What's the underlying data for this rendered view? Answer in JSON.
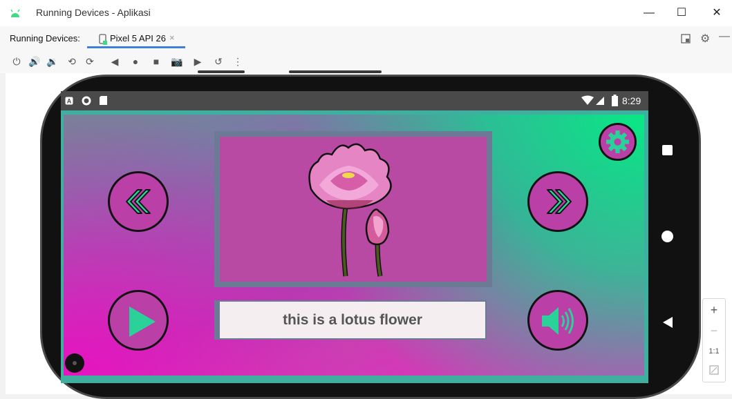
{
  "window": {
    "title": "Running Devices - Aplikasi",
    "minimize": "—",
    "maximize": "☐",
    "close": "✕"
  },
  "tabs": {
    "section_label": "Running Devices:",
    "device_tab": {
      "name": "Pixel 5 API 26",
      "close": "×"
    }
  },
  "toolbar": [
    {
      "name": "power-icon",
      "glyph": "⏻"
    },
    {
      "name": "volume-up-icon",
      "glyph": "🔊"
    },
    {
      "name": "volume-down-icon",
      "glyph": "🔉"
    },
    {
      "name": "rotate-left-icon",
      "glyph": "⟲"
    },
    {
      "name": "rotate-right-icon",
      "glyph": "⟳"
    },
    {
      "name": "back-icon",
      "glyph": "◀"
    },
    {
      "name": "home-icon",
      "glyph": "●"
    },
    {
      "name": "overview-icon",
      "glyph": "■"
    },
    {
      "name": "screenshot-icon",
      "glyph": "📷"
    },
    {
      "name": "screen-record-icon",
      "glyph": "▶"
    },
    {
      "name": "snapshot-icon",
      "glyph": "↺"
    },
    {
      "name": "more-icon",
      "glyph": "⋮"
    }
  ],
  "status_bar": {
    "time": "8:29"
  },
  "app": {
    "caption": "this is a lotus flower"
  },
  "zoom": {
    "in": "+",
    "out": "−",
    "actual": "1:1"
  },
  "colors": {
    "accent_green": "#2ad29a",
    "button_fill": "#ba3fa6",
    "image_bg": "#b84aa4"
  }
}
